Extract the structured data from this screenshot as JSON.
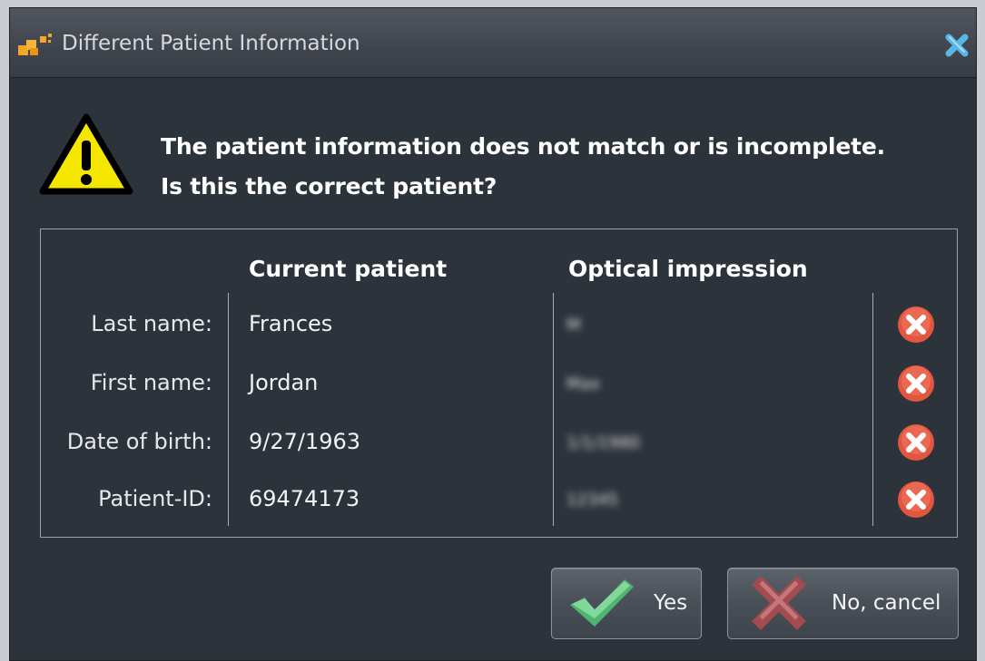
{
  "window": {
    "title": "Different Patient Information"
  },
  "message": {
    "line1": "The patient information does not match or is incomplete.",
    "line2": "Is this the correct patient?"
  },
  "table": {
    "headers": {
      "current": "Current patient",
      "optical": "Optical impression"
    },
    "rows": [
      {
        "label": "Last name:",
        "current": "Frances",
        "optical": "M",
        "match": false
      },
      {
        "label": "First name:",
        "current": "Jordan",
        "optical": "Max",
        "match": false
      },
      {
        "label": "Date of birth:",
        "current": "9/27/1963",
        "optical": "1/1/1980",
        "match": false
      },
      {
        "label": "Patient-ID:",
        "current": "69474173",
        "optical": "12345",
        "match": false
      }
    ]
  },
  "buttons": {
    "yes": "Yes",
    "no": "No, cancel"
  },
  "icons": {
    "app": "app-logo-icon",
    "close": "close-icon",
    "warning": "warning-icon",
    "mismatch": "mismatch-icon",
    "yes": "checkmark-icon",
    "no": "cross-icon"
  },
  "colors": {
    "background": "#2d333b",
    "accent_orange": "#f5a623",
    "warning_yellow": "#f5e600",
    "mismatch_red": "#e2553f",
    "close_blue": "#5bb6e8",
    "check_green": "#6fcf8a"
  }
}
